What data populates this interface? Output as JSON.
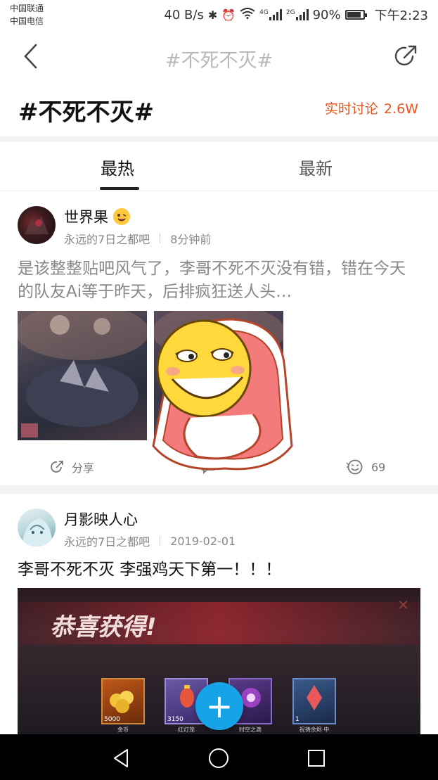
{
  "status_bar": {
    "carrier_1": "中国联通",
    "carrier_2": "中国电信",
    "speed": "40 B/s",
    "net_1": "4G",
    "net_2": "2G",
    "battery": "90%",
    "time": "下午2:23"
  },
  "nav": {
    "title": "#不死不灭#"
  },
  "topic": {
    "title": "#不死不灭#",
    "discuss_label": "实时讨论",
    "discuss_count": "2.6W"
  },
  "tabs": [
    {
      "label": "最热",
      "active": true
    },
    {
      "label": "最新",
      "active": false
    }
  ],
  "posts": [
    {
      "username": "世界果",
      "forum": "永远的7日之都吧",
      "time": "8分钟前",
      "text": "是该整整贴吧风气了，李哥不死不灭没有错，错在今天的队友Ai等于昨天，后排疯狂送人头…",
      "share_label": "分享",
      "like_count": "69"
    },
    {
      "username": "月影映人心",
      "forum": "永远的7日之都吧",
      "time": "2019-02-01",
      "text": "李哥不死不灭 李强鸡天下第一！！！",
      "image_text": {
        "banner": "恭喜获得!",
        "items": [
          {
            "count": "5000",
            "name": "金币"
          },
          {
            "count": "3150",
            "name": "红灯笼"
          },
          {
            "count": "",
            "name": "时空之滴"
          },
          {
            "count": "1",
            "name": "祝祷余烬·中"
          }
        ]
      }
    }
  ],
  "fab_label": "+",
  "colors": {
    "accent": "#e8541e",
    "fab": "#16a3e8"
  }
}
